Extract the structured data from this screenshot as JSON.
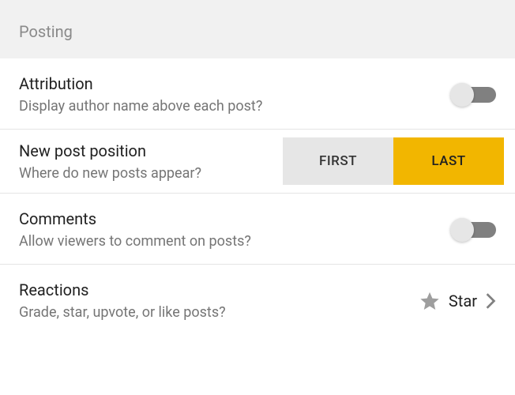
{
  "section": {
    "title": "Posting"
  },
  "rows": {
    "attribution": {
      "title": "Attribution",
      "subtitle": "Display author name above each post?",
      "toggle_on": false
    },
    "position": {
      "title": "New post position",
      "subtitle": "Where do new posts appear?",
      "options": {
        "first": "FIRST",
        "last": "LAST"
      },
      "selected": "last"
    },
    "comments": {
      "title": "Comments",
      "subtitle": "Allow viewers to comment on posts?",
      "toggle_on": false
    },
    "reactions": {
      "title": "Reactions",
      "subtitle": "Grade, star, upvote, or like posts?",
      "value": "Star"
    }
  },
  "colors": {
    "accent": "#f2b600",
    "track": "#808080",
    "knob": "#e6e6e6"
  }
}
